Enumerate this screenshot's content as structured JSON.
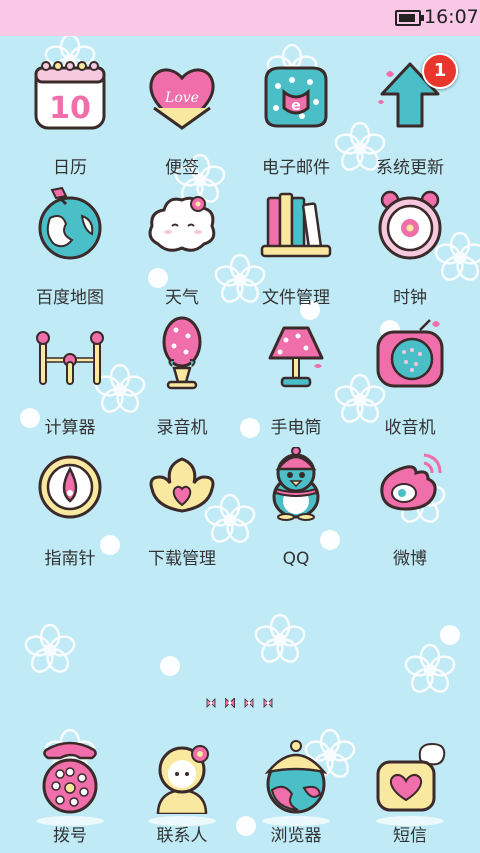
{
  "status_bar": {
    "time": "16:07",
    "battery_icon": "battery-icon"
  },
  "apps": [
    {
      "label": "日历",
      "icon": "calendar-icon"
    },
    {
      "label": "便签",
      "icon": "heart-note-icon"
    },
    {
      "label": "电子邮件",
      "icon": "mail-bag-icon"
    },
    {
      "label": "系统更新",
      "icon": "update-arrow-icon",
      "badge": "1"
    },
    {
      "label": "百度地图",
      "icon": "globe-icon"
    },
    {
      "label": "天气",
      "icon": "cloud-icon"
    },
    {
      "label": "文件管理",
      "icon": "books-icon"
    },
    {
      "label": "时钟",
      "icon": "clock-icon"
    },
    {
      "label": "计算器",
      "icon": "calculator-icon"
    },
    {
      "label": "录音机",
      "icon": "microphone-icon"
    },
    {
      "label": "手电筒",
      "icon": "lamp-icon"
    },
    {
      "label": "收音机",
      "icon": "radio-icon"
    },
    {
      "label": "指南针",
      "icon": "compass-icon"
    },
    {
      "label": "下载管理",
      "icon": "download-shell-icon"
    },
    {
      "label": "QQ",
      "icon": "penguin-icon"
    },
    {
      "label": "微博",
      "icon": "weibo-icon"
    }
  ],
  "page_indicator": {
    "pages": 4,
    "current": 2
  },
  "dock": [
    {
      "label": "拨号",
      "icon": "phone-icon"
    },
    {
      "label": "联系人",
      "icon": "contact-icon"
    },
    {
      "label": "浏览器",
      "icon": "browser-icon"
    },
    {
      "label": "短信",
      "icon": "message-icon"
    }
  ],
  "colors": {
    "background": "#bfeaf6",
    "status_bar": "#f9c8e6",
    "badge": "#e8362c",
    "pink": "#f06eaa",
    "yellow": "#f8e8a0",
    "teal": "#4bbfc8"
  }
}
